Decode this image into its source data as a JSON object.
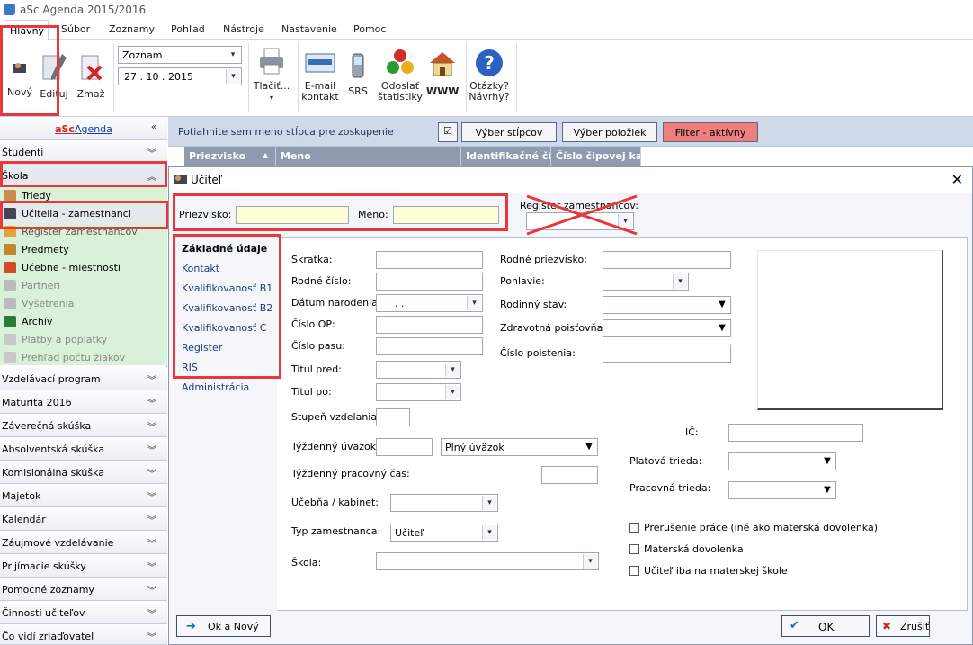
{
  "window": {
    "title": "aSc Agenda 2015/2016"
  },
  "menu": {
    "items": [
      "Hlavný",
      "Súbor",
      "Zoznamy",
      "Pohľad",
      "Nástroje",
      "Nastavenie",
      "Pomoc"
    ]
  },
  "ribbon": {
    "new_label": "Nový",
    "edit_label": "Edituj",
    "delete_label": "Zmaž",
    "list_select_value": "Zoznam",
    "date_value": "27 . 10 . 2015",
    "print_label": "Tlačiť...",
    "email_label_1": "E-mail",
    "email_label_2": "kontakt",
    "srs_label": "SRS",
    "stats_label_1": "Odoslať",
    "stats_label_2": "štatistiky",
    "www_label": "WWW",
    "help_label_1": "Otázky?",
    "help_label_2": "Návrhy?"
  },
  "sidebar": {
    "brand_asc": "aSc",
    "brand_agenda": "Agenda",
    "sections": [
      "Študenti",
      "Škola",
      "Vzdelávací program",
      "Maturita 2016",
      "Záverečná skúška",
      "Absolventská skúška",
      "Komisionálna skúška",
      "Majetok",
      "Kalendár",
      "Záujmové vzdelávanie",
      "Prijímacie skúšky",
      "Pomocné zoznamy",
      "Činnosti učiteľov",
      "Čo vidí zriaďovateľ"
    ],
    "school_items": [
      "Triedy",
      "Učitelia - zamestnanci",
      "Register zamestnancov",
      "Predmety",
      "Učebne - miestnosti",
      "Partneri",
      "Vyšetrenia",
      "Archív",
      "Platby a poplatky",
      "Prehľad počtu žiakov"
    ]
  },
  "list": {
    "grouping_hint": "Potiahnite sem meno stĺpca pre zoskupenie",
    "select_columns": "Výber stĺpcov",
    "select_items": "Výber položiek",
    "filter_active": "Filter - aktívny",
    "columns": [
      "Priezvisko",
      "Meno",
      "Identifikačné čís...",
      "Číslo čipovej kar..."
    ]
  },
  "dialog": {
    "title": "Učiteľ",
    "surname_label": "Priezvisko:",
    "name_label": "Meno:",
    "register_label": "Register zamestnancov:",
    "nav": [
      "Základné údaje",
      "Kontakt",
      "Kvalifikovanosť B1",
      "Kvalifikovanosť B2",
      "Kvalifikovanosť C",
      "Register",
      "RIS",
      "Administrácia"
    ],
    "fields": {
      "skratka": "Skratka:",
      "rodne_cislo": "Rodné číslo:",
      "datum_narodenia": "Dátum narodenia:",
      "datum_value": ".      .",
      "cislo_op": "Číslo OP:",
      "cislo_pasu": "Číslo pasu:",
      "titul_pred": "Titul pred:",
      "titul_po": "Titul po:",
      "rodne_priezvisko": "Rodné priezvisko:",
      "pohlavie": "Pohlavie:",
      "rodinny_stav": "Rodinný stav:",
      "zdravotna_poistovna": "Zdravotná poisťovňa:",
      "cislo_poistenia": "Číslo poistenia:",
      "stupen_vzdelania": "Stupeň vzdelania:",
      "tyzdenny_uvazok": "Týždenný úväzok:",
      "uvazok_value": "Plný úväzok",
      "tyzdenny_pracovny_cas": "Týždenný pracovný čas:",
      "ucebna_kabinet": "Učebňa / kabinet:",
      "typ_zamestnanca": "Typ zamestnanca:",
      "typ_value": "Učiteľ",
      "skola": "Škola:",
      "ic": "IČ:",
      "platova_trieda": "Platová trieda:",
      "pracovna_trieda": "Pracovná trieda:"
    },
    "checkboxes": [
      "Prerušenie práce (iné ako materská dovolenka)",
      "Materská dovolenka",
      "Učiteľ iba na materskej škole"
    ],
    "ok_new": "Ok a Nový",
    "ok": "OK",
    "cancel": "Zrušiť"
  }
}
